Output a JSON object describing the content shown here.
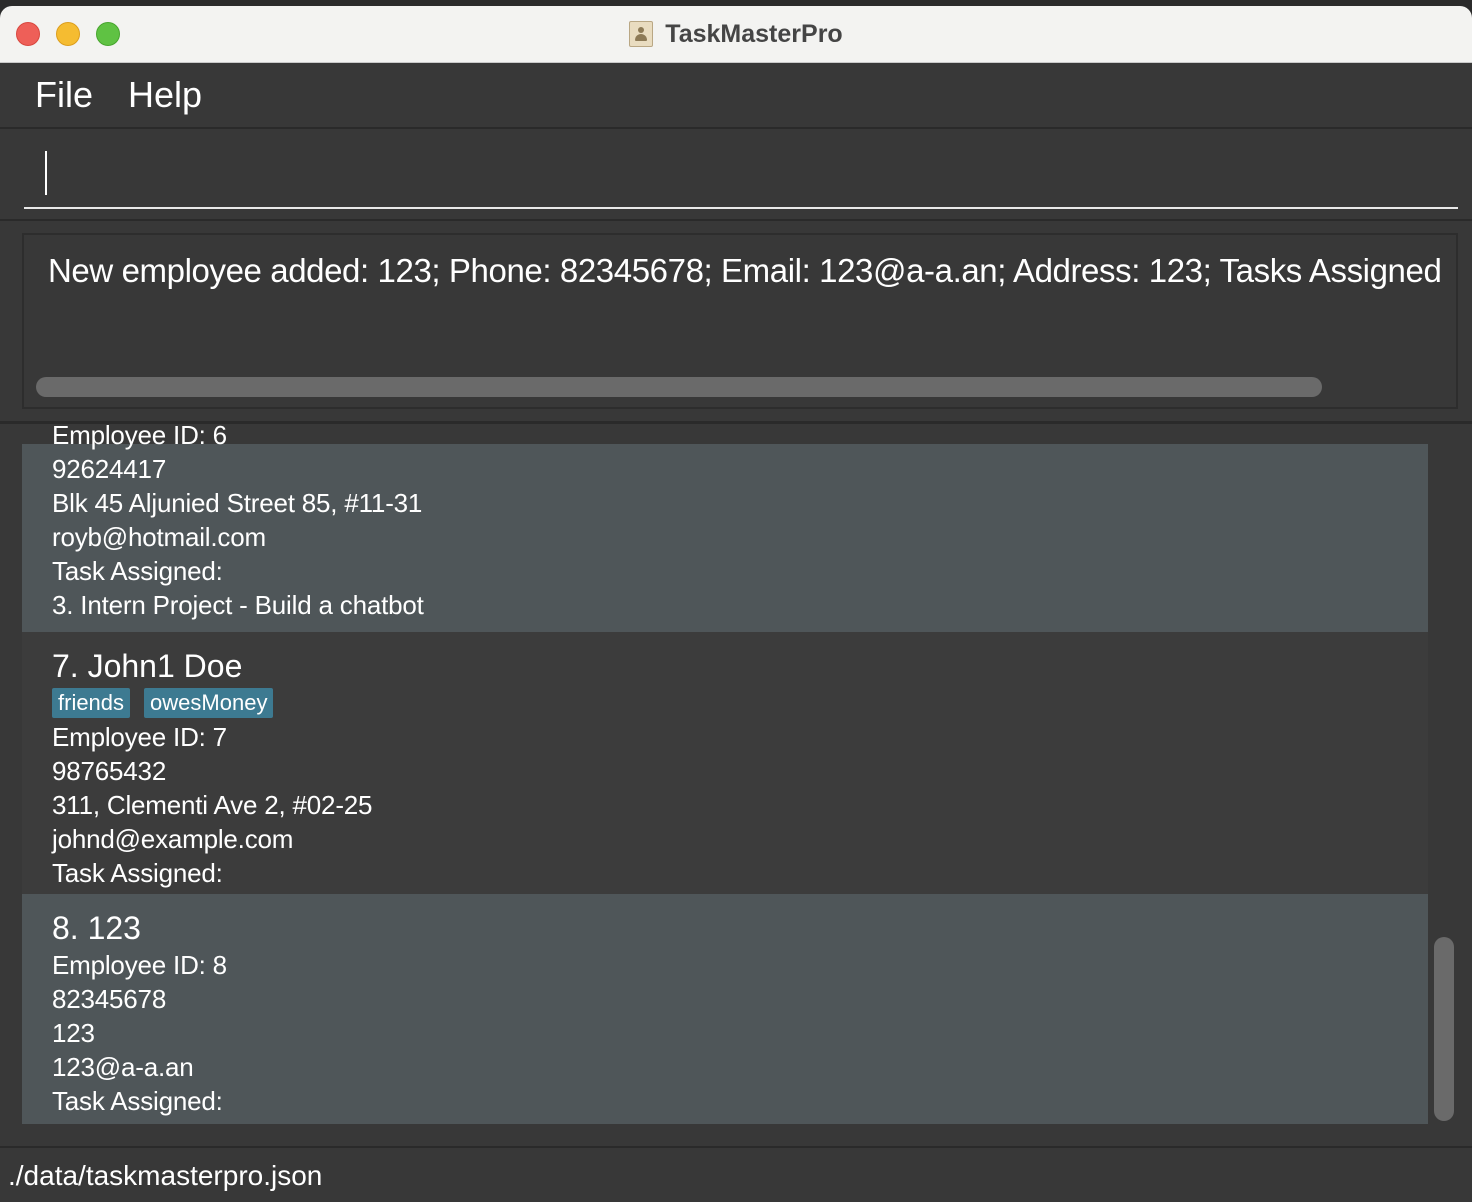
{
  "window": {
    "title": "TaskMasterPro"
  },
  "menu": {
    "file": "File",
    "help": "Help"
  },
  "command": {
    "value": ""
  },
  "result": {
    "text": "New employee added: 123; Phone: 82345678; Email: 123@a-a.an; Address: 123; Tasks Assigned"
  },
  "employees": [
    {
      "phone": "92624417",
      "address": "Blk 45 Aljunied Street 85, #11-31",
      "email": "royb@hotmail.com",
      "task_label": "Task Assigned:",
      "task": "3. Intern Project - Build a chatbot"
    },
    {
      "name": "7.  John1 Doe",
      "tags": [
        "friends",
        "owesMoney"
      ],
      "employee_id": "Employee ID: 7",
      "phone": "98765432",
      "address": "311, Clementi Ave 2, #02-25",
      "email": "johnd@example.com",
      "task_label": "Task Assigned:"
    },
    {
      "name": "8.  123",
      "employee_id": "Employee ID: 8",
      "phone": "82345678",
      "address": "123",
      "email": "123@a-a.an",
      "task_label": "Task Assigned:"
    }
  ],
  "status": {
    "path": "./data/taskmasterpro.json"
  },
  "colors": {
    "background": "#383838",
    "card_light": "#4f5659",
    "card_dark": "#3c3c3c",
    "tag": "#3d7a91"
  }
}
